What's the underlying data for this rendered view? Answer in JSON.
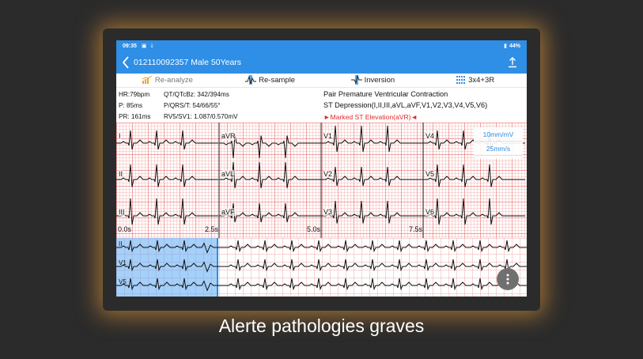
{
  "status_bar": {
    "time": "09:35",
    "battery": "44%"
  },
  "header": {
    "title": "012110092357 Male 50Years"
  },
  "toolbar": {
    "reanalyze_label": "Re-analyze",
    "resample_label": "Re-sample",
    "inversion_label": "Inversion",
    "layout_label": "3x4+3R"
  },
  "measurements": {
    "hr": "HR:79bpm",
    "p": "P:  85ms",
    "pr": "PR:  161ms",
    "qt": "QT/QTcBz:  342/394ms",
    "pqrst": "P/QRS/T:  54/66/55°",
    "rv5sv1": "RV5/SV1:  1.087/0.570mV"
  },
  "diagnosis": {
    "line1": "Pair Premature Ventricular Contraction",
    "line2": "ST Depression(I,II,III,aVL,aVF,V1,V2,V3,V4,V5,V6)",
    "line3": "►Marked ST Elevation(aVR)◄"
  },
  "ecg": {
    "leads": [
      "I",
      "aVR",
      "V1",
      "V4",
      "II",
      "aVL",
      "V2",
      "V5",
      "III",
      "aVF",
      "V3",
      "V6"
    ],
    "time_marks": [
      "0.0s",
      "2.5s",
      "5.0s",
      "7.5s"
    ],
    "gain": "10mm/mV",
    "speed": "25mm/s",
    "rhythm_leads": [
      "II",
      "V1",
      "V5"
    ]
  },
  "colors": {
    "accent": "#2f8ee5",
    "alert": "#e52a2a"
  },
  "caption": "Alerte pathologies graves"
}
